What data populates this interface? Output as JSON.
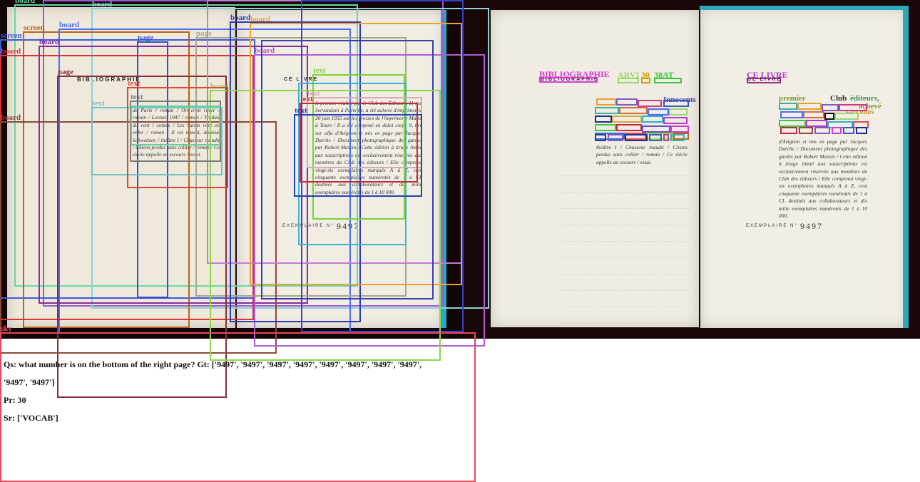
{
  "left_book": {
    "left_heading": "BIBLIOGRAPHIE",
    "bib_text": "de Paris / roman / On croit rêver / roman / Lecture 1947 / roman / Traduit du vent / contes / Les Saints vont en enfer / roman / Il est minuit, docteur Schweitzer, / théâtre I / Chasseur maudit / Chiens perdus sans collier / roman / Ce siècle appelle au secours / essai.",
    "right_heading": "CE LIVRE",
    "colophon": "le premier réalisé par le Club des Éditeurs, 11 rue Servandoni à Paris 6e, a été achevé d'imprimer le 20 juin 1955 sur les presses de l'imprimerie Mame à Tours / Il a été composé en didot corps 9, tiré sur alfa d'Avignon et mis en page par Jacques Darche / Document photographique des gardes par Robert Massin / Cette édition à tirage limité aux souscriptions est exclusivement réservée aux membres du Club des éditeurs / Elle comprend vingt-six exemplaires marqués A à Z, cent cinquante exemplaires numérotés de 1 à CL destinés aux collaborateurs et dix mille exemplaires numérotés de 1 à 10 000.",
    "exemplaire_label": "EXEMPLAIRE N°",
    "exemplaire_number": "9497"
  },
  "right_book": {
    "left_heading": "BIBLIOGRAPHIE",
    "bib_text": "théâtre I / Chasseur maudit / Chiens perdus sans collier / roman / Ce siècle appelle au secours / essai.",
    "right_heading": "CE LIVRE",
    "colophon": "d'Avignon et mis en page par Jacques Darche / Document photographique des gardes par Robert Massin / Cette édition à tirage limité aux souscriptions est exclusivement réservée aux membres du Club des éditeurs / Elle comprend vingt-six exemplaires marqués A à Z, cent cinquante exemplaires numérotés de 1 à CL destinés aux collaborateurs et dix mille exemplaires numérotés de 1 à 10 000.",
    "exemplaire_label": "EXEMPLAIRE N°",
    "exemplaire_number": "9497"
  },
  "right_tags": {
    "bib": "BIBLIOGRAPHIE",
    "arvi": "ARVI",
    "n30": "30",
    "n38at": "38AT",
    "celivre": "CE LIVRE",
    "innocents": "Innocents",
    "premier": "premier",
    "club": "Club",
    "editeurs": "éditeurs,",
    "sarcelles": "sarcelles",
    "acheve": "achevé"
  },
  "box_labels": {
    "board": "board",
    "screen": "screen",
    "page": "page",
    "text": "text",
    "sky": "sky"
  },
  "colors": {
    "photo_bg": "#140606",
    "paper": "#f1ede3",
    "spine": "#2aa8c0"
  },
  "qa": {
    "question": "Qs: what number is on the bottom of the right page? Gt: ['9497', '9497', '9497', '9497', '9497', '9497', '9497', '9497',",
    "question_cont": "'9497', '9497']",
    "prediction": "Pr: 30",
    "score": "Sr: ['VOCAB']"
  }
}
